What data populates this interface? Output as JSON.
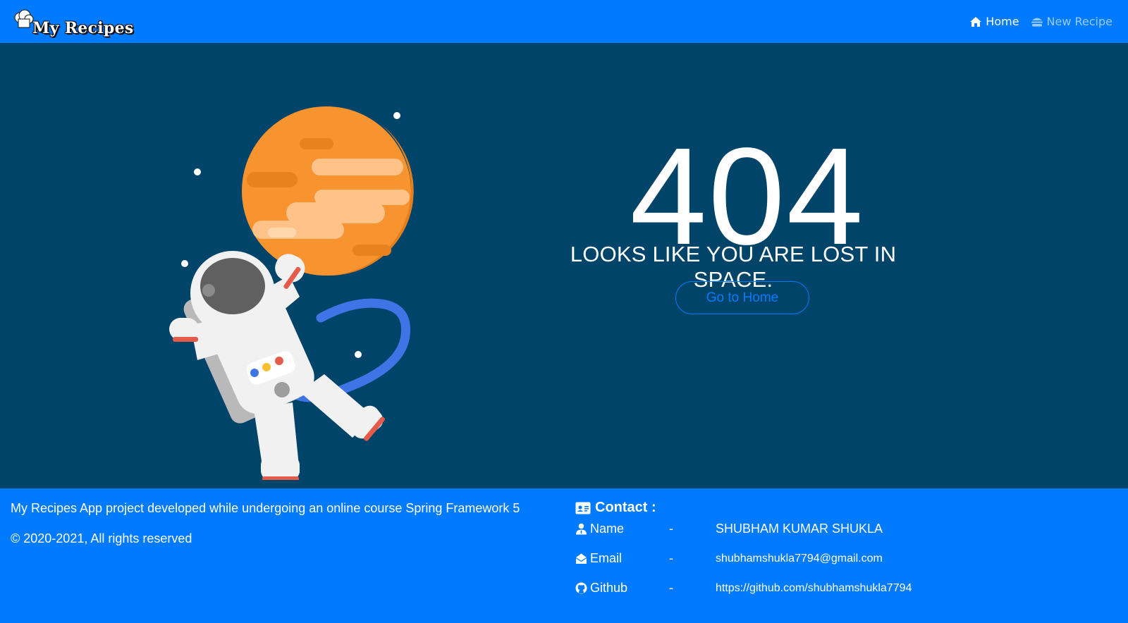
{
  "navbar": {
    "brand": "My Recipes",
    "links": [
      {
        "label": "Home",
        "icon": "home-icon",
        "active": true
      },
      {
        "label": "New Recipe",
        "icon": "burger-icon",
        "active": false
      }
    ]
  },
  "main": {
    "error_code": "404",
    "message": "LOOKS LIKE YOU ARE LOST IN SPACE.",
    "button_label": "Go to Home"
  },
  "footer": {
    "description": "My Recipes App project developed while undergoing an online course Spring Framework 5",
    "copyright": "© 2020-2021, All rights reserved",
    "contact": {
      "title": "Contact :",
      "rows": [
        {
          "label": "Name",
          "icon": "user-icon",
          "separator": "-",
          "value": "SHUBHAM KUMAR SHUKLA"
        },
        {
          "label": "Email",
          "icon": "envelope-icon",
          "separator": "-",
          "value": "shubhamshukla7794@gmail.com"
        },
        {
          "label": "Github",
          "icon": "github-icon",
          "separator": "-",
          "value": "https://github.com/shubhamshukla7794"
        }
      ]
    }
  },
  "colors": {
    "primary": "#007bff",
    "background": "#00446a",
    "planet": "#f79430",
    "tether": "#3f74e6"
  }
}
